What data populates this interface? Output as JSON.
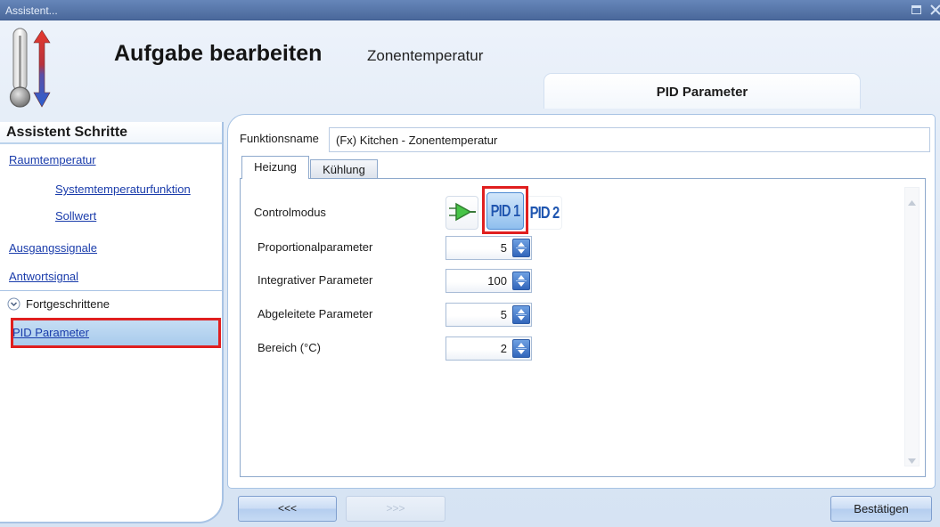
{
  "window": {
    "title": "Assistent...",
    "icons": {
      "restore": "restore-icon",
      "close": "close-icon"
    }
  },
  "header": {
    "icon": "thermometer-icon",
    "title": "Aufgabe bearbeiten",
    "subtitle": "Zonentemperatur",
    "step_title": "PID Parameter"
  },
  "sidebar": {
    "heading": "Assistent Schritte",
    "items": [
      {
        "label": "Raumtemperatur",
        "children": [
          {
            "label": "Systemtemperaturfunktion"
          },
          {
            "label": "Sollwert"
          }
        ]
      },
      {
        "label": "Ausgangssignale"
      },
      {
        "label": "Antwortsignal"
      }
    ],
    "advanced_group": {
      "label": "Fortgeschrittene",
      "icon": "chevron-down-circle-icon",
      "expanded": true,
      "items": [
        {
          "label": "PID Parameter",
          "selected": true
        }
      ]
    }
  },
  "form": {
    "function_name": {
      "label": "Funktionsname",
      "value": "(Fx) Kitchen - Zonentemperatur"
    },
    "tabs": [
      {
        "label": "Heizung",
        "active": true
      },
      {
        "label": "Kühlung",
        "active": false
      }
    ],
    "control_mode": {
      "label": "Controlmodus",
      "options": [
        {
          "icon": "amplifier-icon",
          "selected": false
        },
        {
          "label": "PID 1",
          "selected": true
        },
        {
          "label": "PID 2",
          "selected": false
        }
      ]
    },
    "parameters": [
      {
        "label": "Proportionalparameter",
        "value": "5"
      },
      {
        "label": "Integrativer Parameter",
        "value": "100"
      },
      {
        "label": "Abgeleitete Parameter",
        "value": "5"
      },
      {
        "label": "Bereich (°C)",
        "value": "2"
      }
    ]
  },
  "footer": {
    "back_label": "<<<",
    "next_label": ">>>",
    "next_disabled": true,
    "confirm_label": "Bestätigen"
  },
  "colors": {
    "title_bar_top": "#6686b9",
    "title_bar": "#4a689b",
    "link": "#1a3cab",
    "panel_border": "#a8c3e4",
    "selection_top": "#c8dff5",
    "selection": "#a6c9eb",
    "highlight_border": "#e01f1f"
  }
}
